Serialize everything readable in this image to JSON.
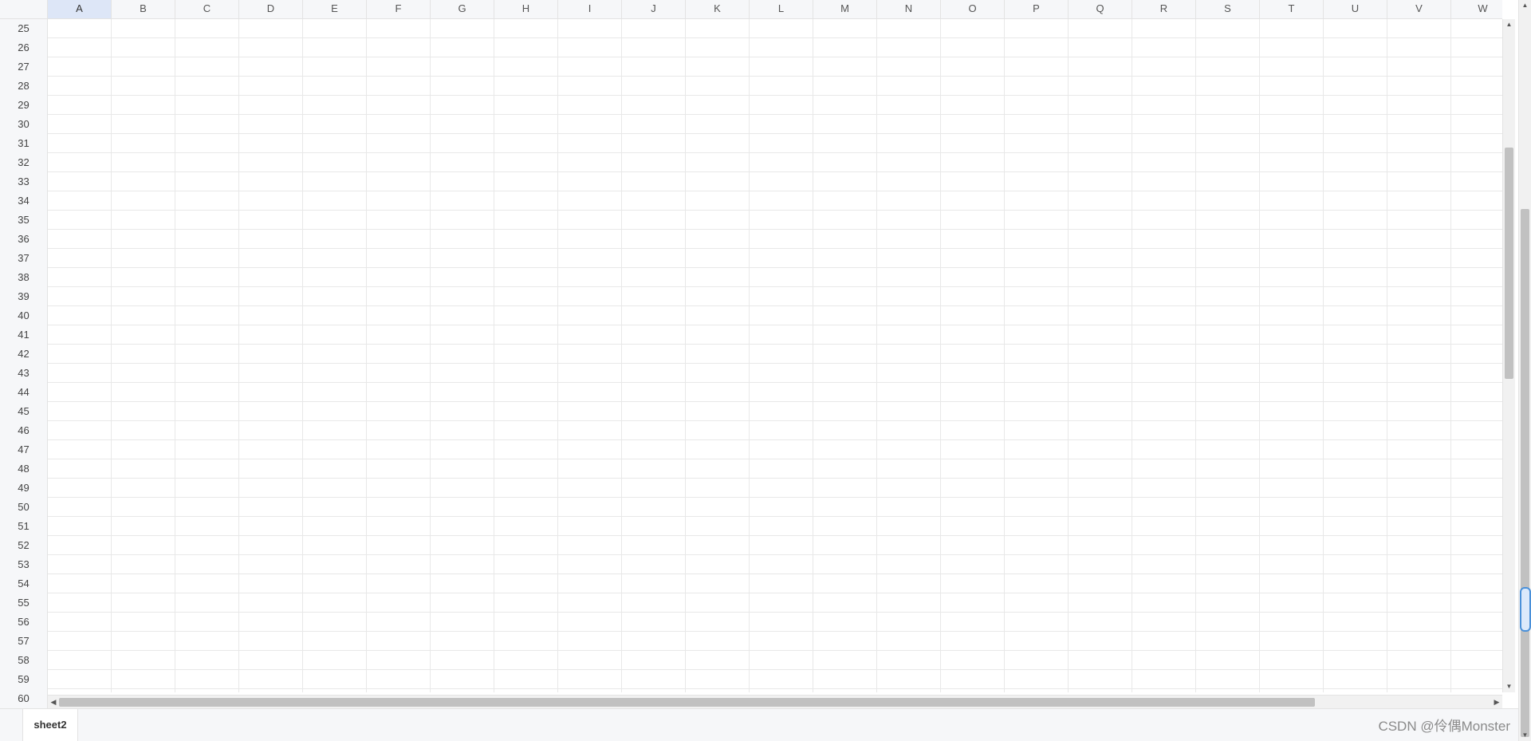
{
  "columns": [
    "A",
    "B",
    "C",
    "D",
    "E",
    "F",
    "G",
    "H",
    "I",
    "J",
    "K",
    "L",
    "M",
    "N",
    "O",
    "P",
    "Q",
    "R",
    "S",
    "T",
    "U",
    "V",
    "W"
  ],
  "selected_column": "A",
  "rows": [
    "25",
    "26",
    "27",
    "28",
    "29",
    "30",
    "31",
    "32",
    "33",
    "34",
    "35",
    "36",
    "37",
    "38",
    "39",
    "40",
    "41",
    "42",
    "43",
    "44",
    "45",
    "46",
    "47",
    "48",
    "49",
    "50",
    "51",
    "52",
    "53",
    "54",
    "55",
    "56",
    "57",
    "58",
    "59",
    "60"
  ],
  "sheet_tabs": [
    {
      "label": "sheet2",
      "active": true
    }
  ],
  "scrollbars": {
    "vertical_position": 0.28,
    "horizontal_position": 0.86,
    "outer_vertical_position": 0.85
  },
  "icons": {
    "up_arrow": "triangle-up-icon",
    "down_arrow": "triangle-down-icon",
    "left_arrow": "triangle-left-icon",
    "right_arrow": "triangle-right-icon"
  },
  "watermark": "CSDN @伶偶Monster"
}
